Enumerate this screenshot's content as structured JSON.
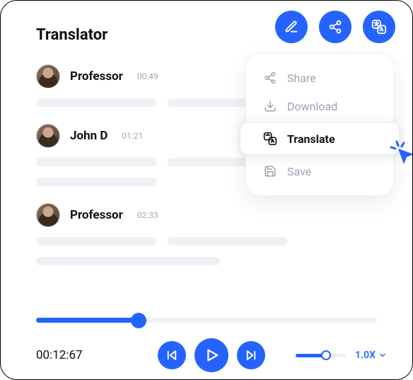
{
  "header": {
    "title": "Translator",
    "actions": {
      "edit": "edit",
      "share": "share",
      "translate": "translate"
    }
  },
  "transcript": [
    {
      "speaker": "Professor",
      "timestamp": "00:49"
    },
    {
      "speaker": "John D",
      "timestamp": "01:21"
    },
    {
      "speaker": "Professor",
      "timestamp": "02:33"
    }
  ],
  "menu": {
    "items": [
      {
        "label": "Share",
        "icon": "share-icon"
      },
      {
        "label": "Download",
        "icon": "download-icon"
      },
      {
        "label": "Translate",
        "icon": "translate-icon",
        "active": true
      },
      {
        "label": "Save",
        "icon": "save-icon"
      }
    ]
  },
  "player": {
    "current_time": "00:12:67",
    "progress_percent": 30,
    "speed_label": "1.0X",
    "speed_percent": 60
  },
  "colors": {
    "accent": "#2563FF",
    "muted": "#9aa1b0",
    "skeleton": "#eef1f5"
  }
}
